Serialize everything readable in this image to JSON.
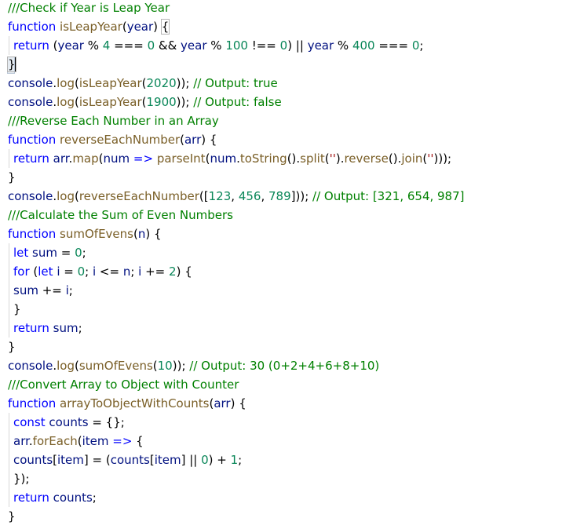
{
  "editor": {
    "lines": [
      {
        "indent": false,
        "tokens": [
          [
            "comment",
            "///Check if Year is Leap Year"
          ]
        ]
      },
      {
        "indent": false,
        "tokens": [
          [
            "keyword",
            "function "
          ],
          [
            "fn",
            "isLeapYear"
          ],
          [
            "plain",
            "("
          ],
          [
            "var",
            "year"
          ],
          [
            "plain",
            ") "
          ],
          [
            "bracket",
            "{"
          ]
        ]
      },
      {
        "indent": true,
        "tokens": [
          [
            "keyword",
            "return "
          ],
          [
            "plain",
            "("
          ],
          [
            "var",
            "year"
          ],
          [
            "plain",
            " % "
          ],
          [
            "num",
            "4"
          ],
          [
            "plain",
            " === "
          ],
          [
            "num",
            "0"
          ],
          [
            "plain",
            " && "
          ],
          [
            "var",
            "year"
          ],
          [
            "plain",
            " % "
          ],
          [
            "num",
            "100"
          ],
          [
            "plain",
            " !== "
          ],
          [
            "num",
            "0"
          ],
          [
            "plain",
            ") || "
          ],
          [
            "var",
            "year"
          ],
          [
            "plain",
            " % "
          ],
          [
            "num",
            "400"
          ],
          [
            "plain",
            " === "
          ],
          [
            "num",
            "0"
          ],
          [
            "plain",
            ";"
          ]
        ]
      },
      {
        "indent": false,
        "cursor": true,
        "tokens": [
          [
            "bracket",
            "}"
          ]
        ]
      },
      {
        "indent": false,
        "tokens": [
          [
            "var",
            "console"
          ],
          [
            "plain",
            "."
          ],
          [
            "fn",
            "log"
          ],
          [
            "plain",
            "("
          ],
          [
            "fn",
            "isLeapYear"
          ],
          [
            "plain",
            "("
          ],
          [
            "num",
            "2020"
          ],
          [
            "plain",
            ")); "
          ],
          [
            "comment",
            "// Output: true"
          ]
        ]
      },
      {
        "indent": false,
        "tokens": [
          [
            "var",
            "console"
          ],
          [
            "plain",
            "."
          ],
          [
            "fn",
            "log"
          ],
          [
            "plain",
            "("
          ],
          [
            "fn",
            "isLeapYear"
          ],
          [
            "plain",
            "("
          ],
          [
            "num",
            "1900"
          ],
          [
            "plain",
            ")); "
          ],
          [
            "comment",
            "// Output: false"
          ]
        ]
      },
      {
        "indent": false,
        "tokens": [
          [
            "comment",
            "///Reverse Each Number in an Array"
          ]
        ]
      },
      {
        "indent": false,
        "tokens": [
          [
            "keyword",
            "function "
          ],
          [
            "fn",
            "reverseEachNumber"
          ],
          [
            "plain",
            "("
          ],
          [
            "var",
            "arr"
          ],
          [
            "plain",
            ") {"
          ]
        ]
      },
      {
        "indent": true,
        "tokens": [
          [
            "keyword",
            "return "
          ],
          [
            "var",
            "arr"
          ],
          [
            "plain",
            "."
          ],
          [
            "fn",
            "map"
          ],
          [
            "plain",
            "("
          ],
          [
            "var",
            "num"
          ],
          [
            "keyword",
            " => "
          ],
          [
            "fn",
            "parseInt"
          ],
          [
            "plain",
            "("
          ],
          [
            "var",
            "num"
          ],
          [
            "plain",
            "."
          ],
          [
            "fn",
            "toString"
          ],
          [
            "plain",
            "()."
          ],
          [
            "fn",
            "split"
          ],
          [
            "plain",
            "("
          ],
          [
            "str",
            "''"
          ],
          [
            "plain",
            ")."
          ],
          [
            "fn",
            "reverse"
          ],
          [
            "plain",
            "()."
          ],
          [
            "fn",
            "join"
          ],
          [
            "plain",
            "("
          ],
          [
            "str",
            "''"
          ],
          [
            "plain",
            ")));"
          ]
        ]
      },
      {
        "indent": false,
        "tokens": [
          [
            "plain",
            "}"
          ]
        ]
      },
      {
        "indent": false,
        "tokens": [
          [
            "var",
            "console"
          ],
          [
            "plain",
            "."
          ],
          [
            "fn",
            "log"
          ],
          [
            "plain",
            "("
          ],
          [
            "fn",
            "reverseEachNumber"
          ],
          [
            "plain",
            "(["
          ],
          [
            "num",
            "123"
          ],
          [
            "plain",
            ", "
          ],
          [
            "num",
            "456"
          ],
          [
            "plain",
            ", "
          ],
          [
            "num",
            "789"
          ],
          [
            "plain",
            "])); "
          ],
          [
            "comment",
            "// Output: [321, 654, 987]"
          ]
        ]
      },
      {
        "indent": false,
        "tokens": [
          [
            "comment",
            "///Calculate the Sum of Even Numbers"
          ]
        ]
      },
      {
        "indent": false,
        "tokens": [
          [
            "keyword",
            "function "
          ],
          [
            "fn",
            "sumOfEvens"
          ],
          [
            "plain",
            "("
          ],
          [
            "var",
            "n"
          ],
          [
            "plain",
            ") {"
          ]
        ]
      },
      {
        "indent": true,
        "tokens": [
          [
            "keyword",
            "let "
          ],
          [
            "var",
            "sum"
          ],
          [
            "plain",
            " = "
          ],
          [
            "num",
            "0"
          ],
          [
            "plain",
            ";"
          ]
        ]
      },
      {
        "indent": true,
        "tokens": [
          [
            "keyword",
            "for "
          ],
          [
            "plain",
            "("
          ],
          [
            "keyword",
            "let "
          ],
          [
            "var",
            "i"
          ],
          [
            "plain",
            " = "
          ],
          [
            "num",
            "0"
          ],
          [
            "plain",
            "; "
          ],
          [
            "var",
            "i"
          ],
          [
            "plain",
            " <= "
          ],
          [
            "var",
            "n"
          ],
          [
            "plain",
            "; "
          ],
          [
            "var",
            "i"
          ],
          [
            "plain",
            " += "
          ],
          [
            "num",
            "2"
          ],
          [
            "plain",
            ") {"
          ]
        ]
      },
      {
        "indent": true,
        "tokens": [
          [
            "var",
            "sum"
          ],
          [
            "plain",
            " += "
          ],
          [
            "var",
            "i"
          ],
          [
            "plain",
            ";"
          ]
        ]
      },
      {
        "indent": true,
        "tokens": [
          [
            "plain",
            "}"
          ]
        ]
      },
      {
        "indent": true,
        "tokens": [
          [
            "keyword",
            "return "
          ],
          [
            "var",
            "sum"
          ],
          [
            "plain",
            ";"
          ]
        ]
      },
      {
        "indent": false,
        "tokens": [
          [
            "plain",
            "}"
          ]
        ]
      },
      {
        "indent": false,
        "tokens": [
          [
            "var",
            "console"
          ],
          [
            "plain",
            "."
          ],
          [
            "fn",
            "log"
          ],
          [
            "plain",
            "("
          ],
          [
            "fn",
            "sumOfEvens"
          ],
          [
            "plain",
            "("
          ],
          [
            "num",
            "10"
          ],
          [
            "plain",
            ")); "
          ],
          [
            "comment",
            "// Output: 30 (0+2+4+6+8+10)"
          ]
        ]
      },
      {
        "indent": false,
        "tokens": [
          [
            "comment",
            "///Convert Array to Object with Counter"
          ]
        ]
      },
      {
        "indent": false,
        "tokens": [
          [
            "keyword",
            "function "
          ],
          [
            "fn",
            "arrayToObjectWithCounts"
          ],
          [
            "plain",
            "("
          ],
          [
            "var",
            "arr"
          ],
          [
            "plain",
            ") {"
          ]
        ]
      },
      {
        "indent": true,
        "tokens": [
          [
            "keyword",
            "const "
          ],
          [
            "var",
            "counts"
          ],
          [
            "plain",
            " = {};"
          ]
        ]
      },
      {
        "indent": true,
        "tokens": [
          [
            "var",
            "arr"
          ],
          [
            "plain",
            "."
          ],
          [
            "fn",
            "forEach"
          ],
          [
            "plain",
            "("
          ],
          [
            "var",
            "item"
          ],
          [
            "keyword",
            " => "
          ],
          [
            "plain",
            "{"
          ]
        ]
      },
      {
        "indent": true,
        "tokens": [
          [
            "var",
            "counts"
          ],
          [
            "plain",
            "["
          ],
          [
            "var",
            "item"
          ],
          [
            "plain",
            "] = ("
          ],
          [
            "var",
            "counts"
          ],
          [
            "plain",
            "["
          ],
          [
            "var",
            "item"
          ],
          [
            "plain",
            "] || "
          ],
          [
            "num",
            "0"
          ],
          [
            "plain",
            ") + "
          ],
          [
            "num",
            "1"
          ],
          [
            "plain",
            ";"
          ]
        ]
      },
      {
        "indent": true,
        "tokens": [
          [
            "plain",
            "});"
          ]
        ]
      },
      {
        "indent": true,
        "tokens": [
          [
            "keyword",
            "return "
          ],
          [
            "var",
            "counts"
          ],
          [
            "plain",
            ";"
          ]
        ]
      },
      {
        "indent": false,
        "tokens": [
          [
            "plain",
            "}"
          ]
        ]
      }
    ]
  }
}
